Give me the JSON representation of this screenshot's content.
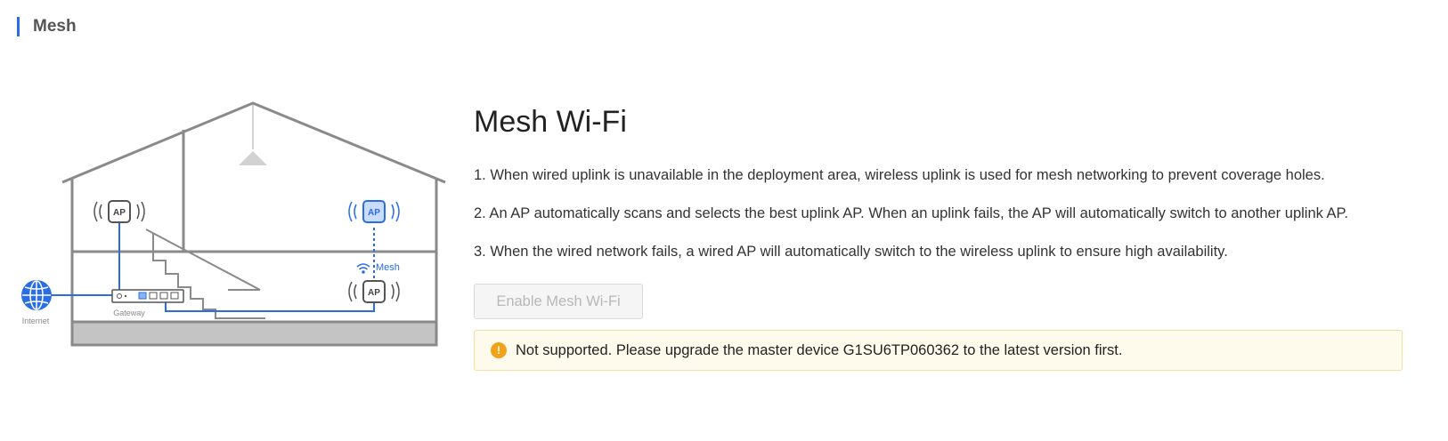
{
  "section": {
    "title": "Mesh"
  },
  "illustration": {
    "ap_label": "AP",
    "mesh_label": "Mesh",
    "gateway_label": "Gateway",
    "internet_label": "Internet"
  },
  "main": {
    "title": "Mesh Wi-Fi",
    "descriptions": [
      "1. When wired uplink is unavailable in the deployment area, wireless uplink is used for mesh networking to prevent coverage holes.",
      "2. An AP automatically scans and selects the best uplink AP. When an uplink fails, the AP will automatically switch to another uplink AP.",
      "3. When the wired network fails, a wired AP will automatically switch to the wireless uplink to ensure high availability."
    ],
    "enable_button": "Enable Mesh Wi-Fi",
    "notice": {
      "icon": "warning-icon",
      "text": "Not supported. Please upgrade the master device G1SU6TP060362 to the latest version first."
    }
  },
  "colors": {
    "accent": "#2b6de5",
    "warning": "#f1a21b",
    "notice_bg": "#fffbec",
    "notice_border": "#f5dfa3"
  }
}
